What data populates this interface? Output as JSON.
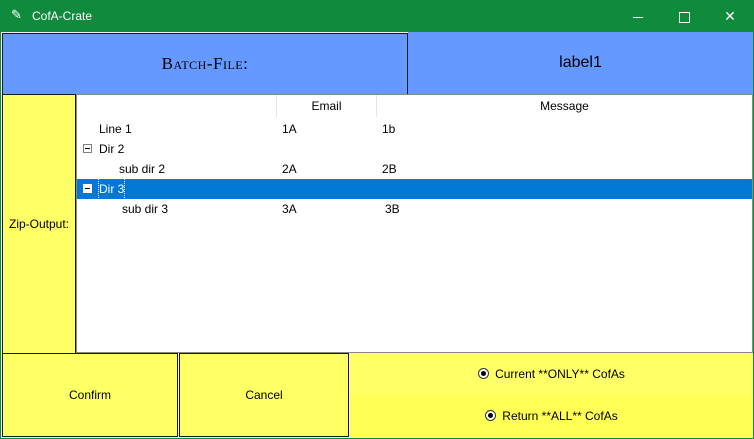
{
  "window": {
    "title": "CofA-Crate",
    "icon": "feather-icon",
    "controls": {
      "minimize": "minimize-icon",
      "maximize": "maximize-icon",
      "close": "✕"
    }
  },
  "header": {
    "batch_file_label": "Batch-File:",
    "label1": "label1"
  },
  "sidebar": {
    "zip_output_label": "Zip-Output:"
  },
  "tree": {
    "columns": [
      "",
      "Email",
      "Message"
    ],
    "rows": [
      {
        "text": "Line 1",
        "email": "1A",
        "message": "1b",
        "level": 0,
        "expander": false,
        "selected": false
      },
      {
        "text": "Dir 2",
        "email": "",
        "message": "",
        "level": 0,
        "expander": true,
        "expanded": true,
        "selected": false
      },
      {
        "text": "sub dir 2",
        "email": "2A",
        "message": "2B",
        "level": 1,
        "expander": false,
        "selected": false
      },
      {
        "text": "Dir 3",
        "email": "",
        "message": "",
        "level": 0,
        "expander": true,
        "expanded": true,
        "selected": true
      },
      {
        "text": "sub dir 3",
        "email": "3A",
        "message": "3B",
        "level": 1,
        "expander": false,
        "selected": false
      }
    ]
  },
  "buttons": {
    "confirm": "Confirm",
    "cancel": "Cancel"
  },
  "options": {
    "current_only": "Current **ONLY** CofAs",
    "return_all": "Return **ALL** CofAs"
  },
  "colors": {
    "titlebar": "#108a3d",
    "header_bg": "#6699ff",
    "panel_yellow": "#ffff66",
    "selection": "#0078d7"
  }
}
